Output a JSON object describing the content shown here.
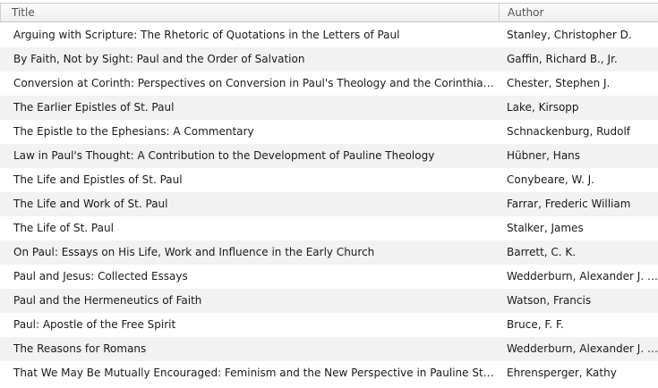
{
  "columns": {
    "title": "Title",
    "author": "Author"
  },
  "rows": [
    {
      "title": "Arguing with Scripture: The Rhetoric of Quotations in the Letters of Paul",
      "author": "Stanley, Christopher D."
    },
    {
      "title": "By Faith, Not by Sight: Paul and the Order of Salvation",
      "author": "Gaffin, Richard B., Jr."
    },
    {
      "title": "Conversion at Corinth: Perspectives on Conversion in Paul's Theology and the Corinthian Church",
      "author": "Chester, Stephen J."
    },
    {
      "title": "The Earlier Epistles of St. Paul",
      "author": "Lake, Kirsopp"
    },
    {
      "title": "The Epistle to the Ephesians: A Commentary",
      "author": "Schnackenburg, Rudolf"
    },
    {
      "title": "Law in Paul's Thought: A Contribution to the Development of Pauline Theology",
      "author": "Hübner, Hans"
    },
    {
      "title": "The Life and Epistles of St. Paul",
      "author": "Conybeare, W. J."
    },
    {
      "title": "The Life and Work of St. Paul",
      "author": "Farrar, Frederic William"
    },
    {
      "title": "The Life of St. Paul",
      "author": "Stalker, James"
    },
    {
      "title": "On Paul: Essays on His Life, Work and Influence in the Early Church",
      "author": "Barrett, C. K."
    },
    {
      "title": "Paul and Jesus: Collected Essays",
      "author": "Wedderburn, Alexander J. M."
    },
    {
      "title": "Paul and the Hermeneutics of Faith",
      "author": "Watson, Francis"
    },
    {
      "title": "Paul: Apostle of the Free Spirit",
      "author": "Bruce, F. F."
    },
    {
      "title": "The Reasons for Romans",
      "author": "Wedderburn, Alexander J. M."
    },
    {
      "title": "That We May Be Mutually Encouraged: Feminism and the New Perspective in Pauline Studies",
      "author": "Ehrensperger, Kathy"
    }
  ]
}
